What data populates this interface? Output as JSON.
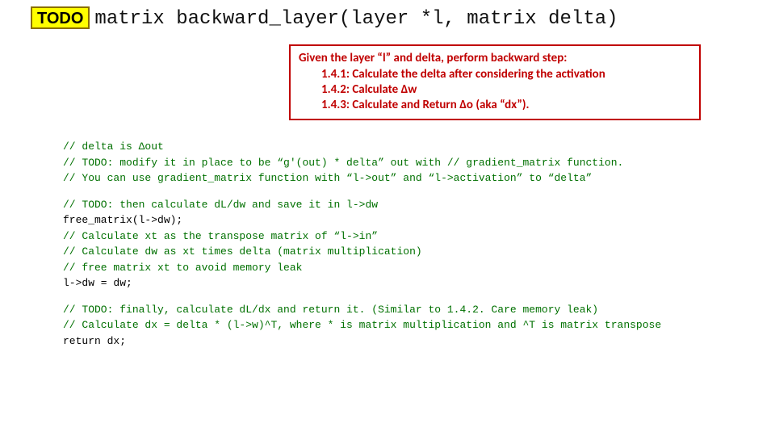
{
  "title": {
    "todo_text": "TODO",
    "signature": "matrix backward_layer(layer *l, matrix delta)"
  },
  "instructions": {
    "head": "Given the layer “l” and delta, perform backward step:",
    "items": [
      "1.4.1: Calculate the delta after considering the activation",
      "1.4.2: Calculate Δw",
      "1.4.3: Calculate and Return Δo (aka “dx”)."
    ]
  },
  "code": {
    "l01": "// delta is Δout",
    "l02": "// TODO: modify it in place to be “g'(out) * delta” out with // gradient_matrix function.",
    "l03": "// You can use gradient_matrix function with “l->out” and “l->activation” to “delta”",
    "l04": "// TODO: then calculate dL/dw and save it in l->dw",
    "l05_a": "free_matrix",
    "l05_b": "(l->dw);",
    "l06": "// Calculate xt as the transpose matrix of “l->in”",
    "l07": "// Calculate dw as xt times delta (matrix multiplication)",
    "l08": "// free matrix xt to avoid memory leak",
    "l09": "l->dw = dw;",
    "l10": "// TODO: finally, calculate dL/dx and return it. (Similar to 1.4.2. Care memory leak)",
    "l11": "// Calculate dx = delta * (l->w)^T,   where * is matrix multiplication and ^T is matrix transpose",
    "l12_a": "return",
    "l12_b": " dx;"
  }
}
